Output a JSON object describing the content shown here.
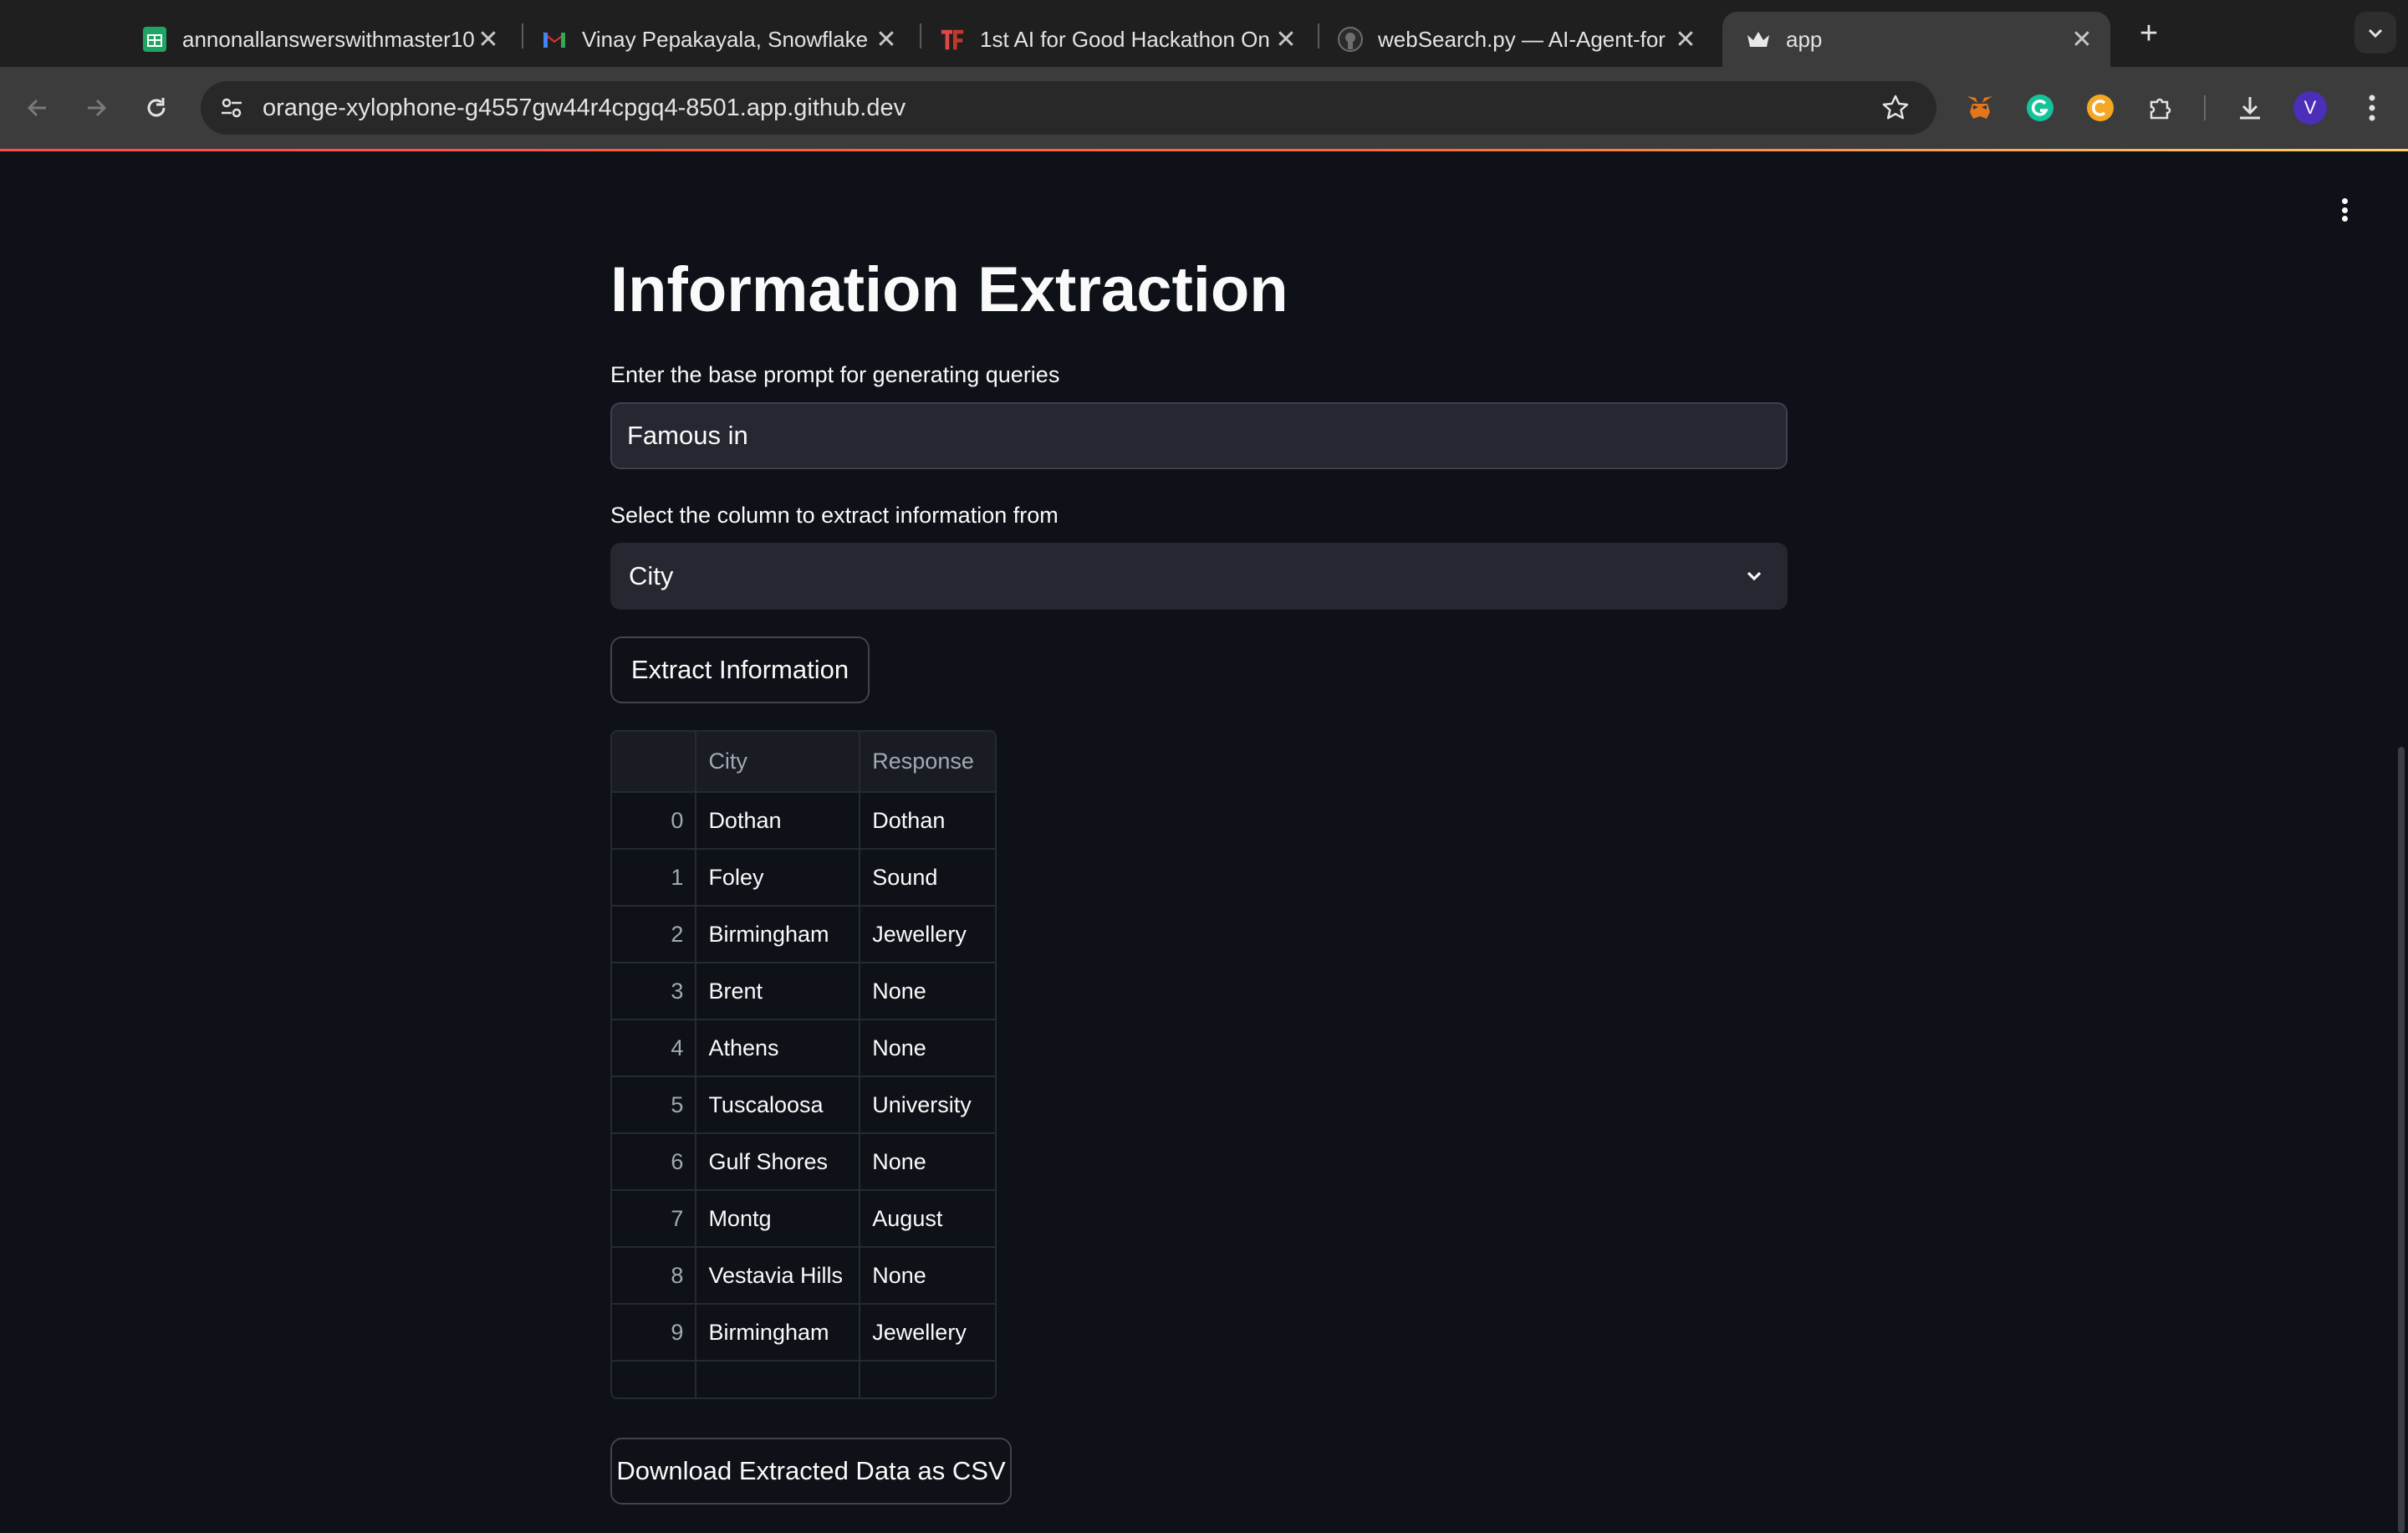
{
  "tabs": [
    {
      "title": "annonallanswerswithmaster10",
      "icon": "google-sheets-icon",
      "active": false
    },
    {
      "title": "Vinay Pepakayala, Snowflake",
      "icon": "gmail-icon",
      "active": false
    },
    {
      "title": "1st AI for Good Hackathon On",
      "icon": "hackathon-logo-icon",
      "active": false
    },
    {
      "title": "webSearch.py — AI-Agent-for",
      "icon": "github-icon",
      "active": false
    },
    {
      "title": "app",
      "icon": "streamlit-crown-icon",
      "active": true
    }
  ],
  "address_bar": {
    "url": "orange-xylophone-g4557gw44r4cpgq4-8501.app.github.dev"
  },
  "profile": {
    "initial": "V",
    "color": "#4b2fb8"
  },
  "app": {
    "title": "Information Extraction",
    "prompt_label": "Enter the base prompt for generating queries",
    "prompt_value": "Famous in",
    "column_label": "Select the column to extract information from",
    "column_value": "City",
    "extract_button": "Extract Information",
    "download_button": "Download Extracted Data as CSV"
  },
  "table": {
    "columns": [
      "",
      "City",
      "Response"
    ],
    "rows": [
      {
        "index": "0",
        "city": "Dothan",
        "response": "Dothan"
      },
      {
        "index": "1",
        "city": "Foley",
        "response": "Sound"
      },
      {
        "index": "2",
        "city": "Birmingham",
        "response": "Jewellery"
      },
      {
        "index": "3",
        "city": "Brent",
        "response": "None"
      },
      {
        "index": "4",
        "city": "Athens",
        "response": "None"
      },
      {
        "index": "5",
        "city": "Tuscaloosa",
        "response": "University"
      },
      {
        "index": "6",
        "city": "Gulf Shores",
        "response": "None"
      },
      {
        "index": "7",
        "city": "Montg",
        "response": "August"
      },
      {
        "index": "8",
        "city": "Vestavia Hills",
        "response": "None"
      },
      {
        "index": "9",
        "city": "Birmingham",
        "response": "Jewellery"
      }
    ]
  },
  "colors": {
    "background": "#0e1117",
    "input": "#262730",
    "chrome": "#3c3c3c",
    "accent": "#ff4b4b"
  }
}
